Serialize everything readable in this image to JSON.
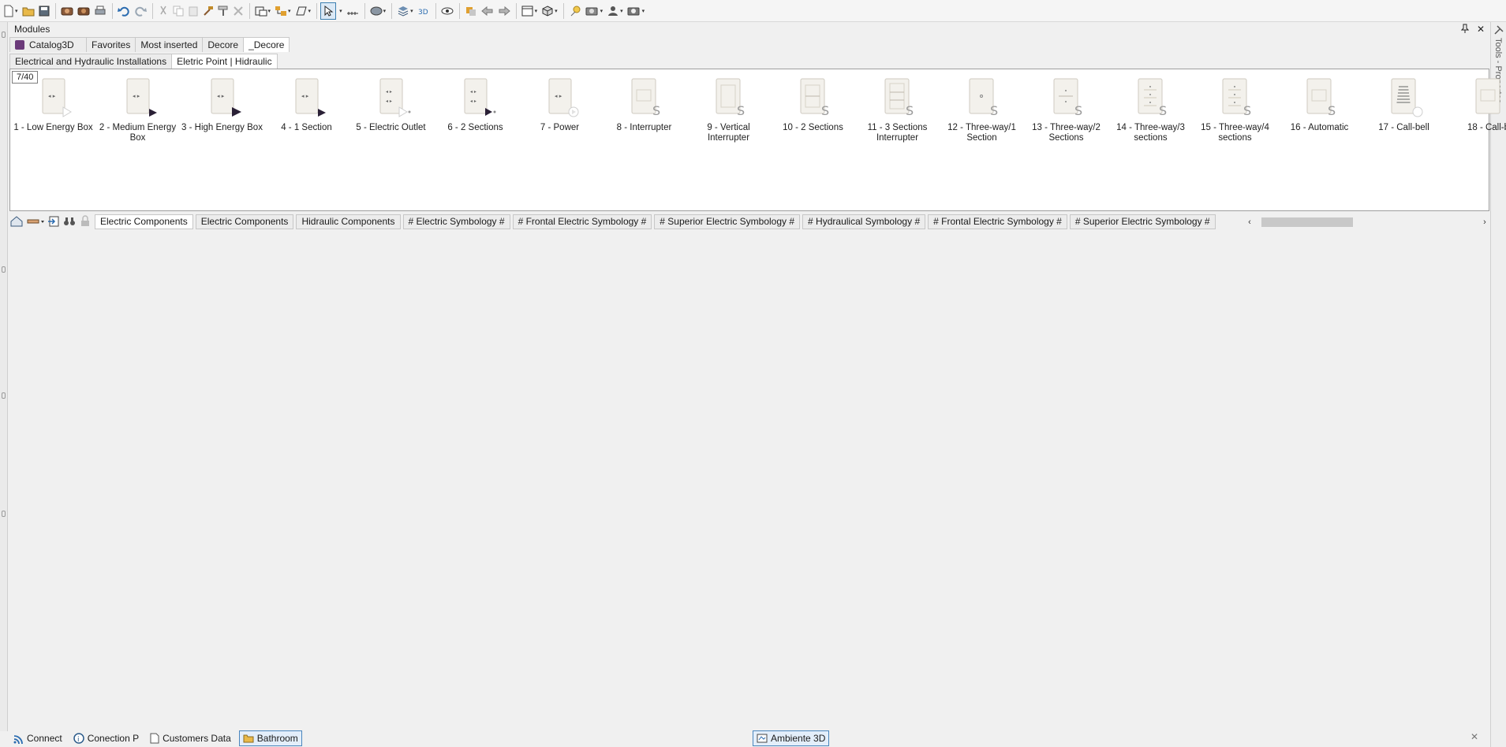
{
  "toolbar": {
    "icons": [
      "new-file-icon",
      "open-folder-icon",
      "save-icon",
      "render-icon",
      "render-batch-icon",
      "print-icon",
      "undo-icon",
      "redo-icon",
      "cut-icon",
      "copy-icon",
      "paste-icon",
      "hammer-icon",
      "paint-roller-icon",
      "delete-icon",
      "walls-icon",
      "layout-icon",
      "shape-icon",
      "select-arrow-icon",
      "measure-icon",
      "layers-icon",
      "box-stack-icon",
      "3d-view-icon",
      "eye-icon",
      "move-icon",
      "nav-back-icon",
      "nav-forward-icon",
      "window-icon",
      "cube-icon",
      "light-icon",
      "camera-icon",
      "person-icon",
      "photo-icon"
    ]
  },
  "modules": {
    "title": "Modules",
    "pin": "↑",
    "close": "✕"
  },
  "tabs_row1": [
    {
      "label": "Catalog3D",
      "icon": "cube-icon"
    },
    {
      "label": "Favorites"
    },
    {
      "label": "Most inserted"
    },
    {
      "label": "Decore"
    },
    {
      "label": "_Decore"
    }
  ],
  "tabs_row2": [
    {
      "label": "Electrical and Hydraulic Installations"
    },
    {
      "label": "Eletric Point | Hidraulic"
    }
  ],
  "catalog": {
    "count": "7/40",
    "items": [
      {
        "label": "1 - Low Energy Box",
        "kind": "box",
        "mark": "outline-triangle"
      },
      {
        "label": "2 - Medium Energy Box",
        "kind": "box",
        "mark": "filled-triangle-small"
      },
      {
        "label": "3 - High Energy Box",
        "kind": "box",
        "mark": "filled-triangle"
      },
      {
        "label": "4 - 1 Section",
        "kind": "box",
        "mark": "filled-triangle-small"
      },
      {
        "label": "5 - Electric Outlet",
        "kind": "box2",
        "mark": "outline-triangle-dot"
      },
      {
        "label": "6 - 2 Sections",
        "kind": "box2",
        "mark": "filled-triangle-dot"
      },
      {
        "label": "7 - Power",
        "kind": "box",
        "mark": "outline-circle"
      },
      {
        "label": "8 - Interrupter",
        "kind": "plate",
        "mark": "S"
      },
      {
        "label": "9 - Vertical Interrupter",
        "kind": "plate-v",
        "mark": "S"
      },
      {
        "label": "10 - 2 Sections",
        "kind": "plate-2",
        "mark": "S"
      },
      {
        "label": "11 - 3 Sections Interrupter",
        "kind": "plate-3",
        "mark": "S"
      },
      {
        "label": "12 - Three-way/1 Section",
        "kind": "plate-dot",
        "mark": "S"
      },
      {
        "label": "13 - Three-way/2 Sections",
        "kind": "plate-dot2",
        "mark": "S"
      },
      {
        "label": "14 - Three-way/3 sections",
        "kind": "plate-dot3",
        "mark": "S"
      },
      {
        "label": "15 - Three-way/4 sections",
        "kind": "plate-dot3",
        "mark": "S"
      },
      {
        "label": "16 - Automatic",
        "kind": "plate",
        "mark": "S"
      },
      {
        "label": "17 - Call-bell",
        "kind": "bell",
        "mark": "circle"
      },
      {
        "label": "18 - Call-b",
        "kind": "plate",
        "mark": "none"
      }
    ]
  },
  "lower_tabs": [
    {
      "label": "Electric Components"
    },
    {
      "label": "Electric Components"
    },
    {
      "label": "Hidraulic Components"
    },
    {
      "label": "# Electric Symbology #"
    },
    {
      "label": "# Frontal Electric Symbology #"
    },
    {
      "label": "# Superior Electric Symbology #"
    },
    {
      "label": "# Hydraulical Symbology #"
    },
    {
      "label": "# Frontal Electric Symbology #"
    },
    {
      "label": "# Superior Electric Symbology #"
    }
  ],
  "right_strip": {
    "label": "Tools - Propertes"
  },
  "bottom_bar": {
    "items": [
      {
        "label": "Connect",
        "icon": "wifi-icon"
      },
      {
        "label": "Conection P",
        "icon": "info-icon"
      },
      {
        "label": "Customers Data",
        "icon": "document-icon"
      },
      {
        "label": "Bathroom",
        "icon": "folder-icon"
      },
      {
        "label": "Ambiente 3D",
        "icon": "3d-window-icon"
      }
    ],
    "close": "✕"
  },
  "colors": {
    "accent": "#3c7fb1",
    "catalog_cube": "#6b3a7a",
    "item_dark": "#2a2036"
  }
}
